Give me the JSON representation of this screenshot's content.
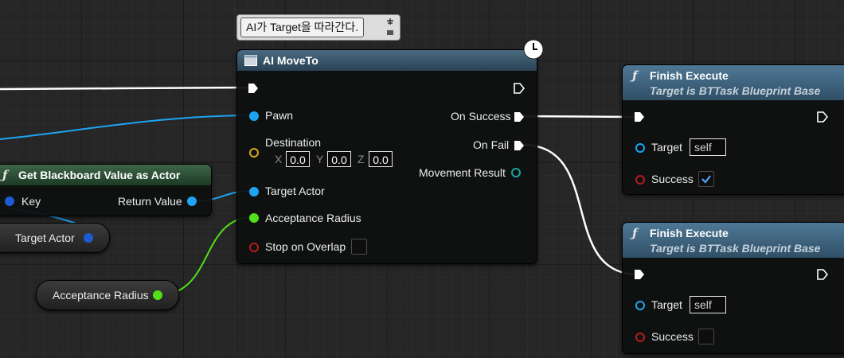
{
  "comment": {
    "text": "AI가 Target을 따라간다."
  },
  "ai_moveto": {
    "title": "AI MoveTo",
    "inputs": {
      "pawn": "Pawn",
      "destination": "Destination",
      "dest_x_label": "X",
      "dest_x": "0.0",
      "dest_y_label": "Y",
      "dest_y": "0.0",
      "dest_z_label": "Z",
      "dest_z": "0.0",
      "target_actor": "Target Actor",
      "acceptance_radius": "Acceptance Radius",
      "stop_on_overlap": "Stop on Overlap"
    },
    "outputs": {
      "on_success": "On Success",
      "on_fail": "On Fail",
      "movement_result": "Movement Result"
    }
  },
  "get_blackboard": {
    "title": "Get Blackboard Value as Actor",
    "key": "Key",
    "return_value": "Return Value"
  },
  "target_actor_var": {
    "label": "Target Actor"
  },
  "acceptance_radius_var": {
    "label": "Acceptance Radius"
  },
  "finish_execute_1": {
    "title": "Finish Execute",
    "subtitle": "Target is BTTask Blueprint Base",
    "target_label": "Target",
    "target_value": "self",
    "success_label": "Success",
    "success_checked": true
  },
  "finish_execute_2": {
    "title": "Finish Execute",
    "subtitle": "Target is BTTask Blueprint Base",
    "target_label": "Target",
    "target_value": "self",
    "success_label": "Success",
    "success_checked": false
  },
  "colors": {
    "exec": "#ffffff",
    "object_pin": "#1ea4f2",
    "float_pin": "#52e01a",
    "bool_pin": "#b31c1c",
    "function_header": "#1a3d56",
    "pure_header": "#1d4a28"
  }
}
